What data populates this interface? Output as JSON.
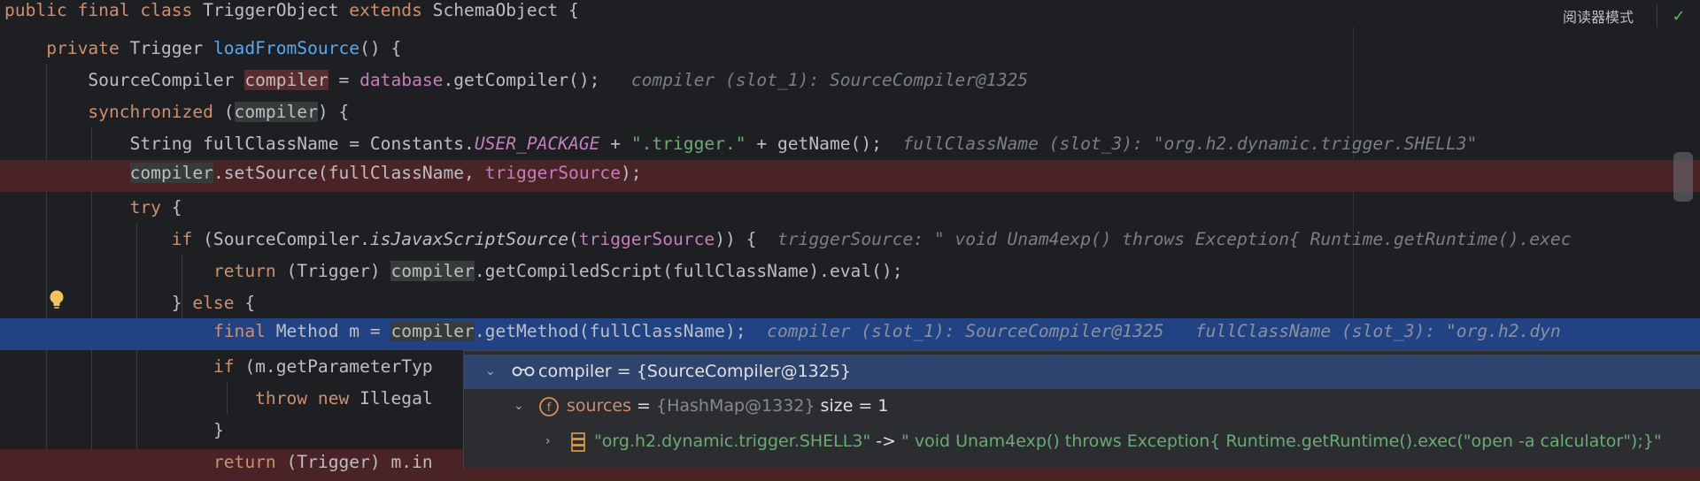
{
  "header": {
    "reader_mode_label": "阅读器模式",
    "check_icon": "check-icon"
  },
  "code": {
    "line1": {
      "kw1": "public",
      "kw2": "final",
      "kw3": "class",
      "name": " TriggerObject ",
      "kw4": "extends",
      "rest": " SchemaObject {"
    },
    "line2": {
      "kw": "private",
      "type": " Trigger ",
      "fn": "loadFromSource",
      "rest": "() {"
    },
    "line3": {
      "type": "SourceCompiler ",
      "var": "compiler",
      "eq": " = ",
      "fld": "database",
      "rest": ".getCompiler();",
      "hint": "compiler (slot_1): SourceCompiler@1325"
    },
    "line4": {
      "kw": "synchronized",
      "open": " (",
      "var": "compiler",
      "rest": ") {"
    },
    "line5": {
      "a": "String fullClassName = Constants.",
      "st": "USER_PACKAGE",
      "b": " + ",
      "str": "\".trigger.\"",
      "c": " + getName();",
      "hint": "fullClassName (slot_3): \"org.h2.dynamic.trigger.SHELL3\""
    },
    "line6": {
      "var": "compiler",
      "a": ".setSource(fullClassName, ",
      "par": "triggerSource",
      "b": ");"
    },
    "line7": {
      "kw": "try",
      "rest": " {"
    },
    "line8": {
      "kw": "if",
      "a": " (SourceCompiler.",
      "it": "isJavaxScriptSource",
      "b": "(",
      "par": "triggerSource",
      "c": ")) {",
      "hint": "triggerSource: \" void Unam4exp() throws Exception{ Runtime.getRuntime().exec"
    },
    "line9": {
      "kw": "return",
      "a": " (Trigger) ",
      "var": "compiler",
      "b": ".getCompiledScript(fullClassName).eval();"
    },
    "line10": {
      "a": "} ",
      "kw": "else",
      "b": " {"
    },
    "line11": {
      "kw": "final",
      "a": " Method m = ",
      "var": "compiler",
      "b": ".getMethod(fullClassName);",
      "hint1": "compiler (slot_1): SourceCompiler@1325",
      "hint2": "fullClassName (slot_3): \"org.h2.dyn"
    },
    "line12": {
      "kw": "if",
      "a": " (m.getParameterTyp"
    },
    "line13": {
      "kw1": "throw",
      "kw2": "new",
      "a": " Illegal"
    },
    "line14": {
      "a": "}"
    },
    "line15": {
      "kw": "return",
      "a": " (Trigger) m.in"
    }
  },
  "debugger": {
    "row1": {
      "name": "compiler",
      "eq": " = ",
      "value": "{SourceCompiler@1325}"
    },
    "row2": {
      "name": "sources",
      "eq": " = ",
      "type": "{HashMap@1332}",
      "size": "size = 1"
    },
    "row3": {
      "key": "\"org.h2.dynamic.trigger.SHELL3\"",
      "arrow": " -> ",
      "value": "\" void Unam4exp() throws Exception{ Runtime.getRuntime().exec(\"open -a calculator\");}\""
    }
  }
}
